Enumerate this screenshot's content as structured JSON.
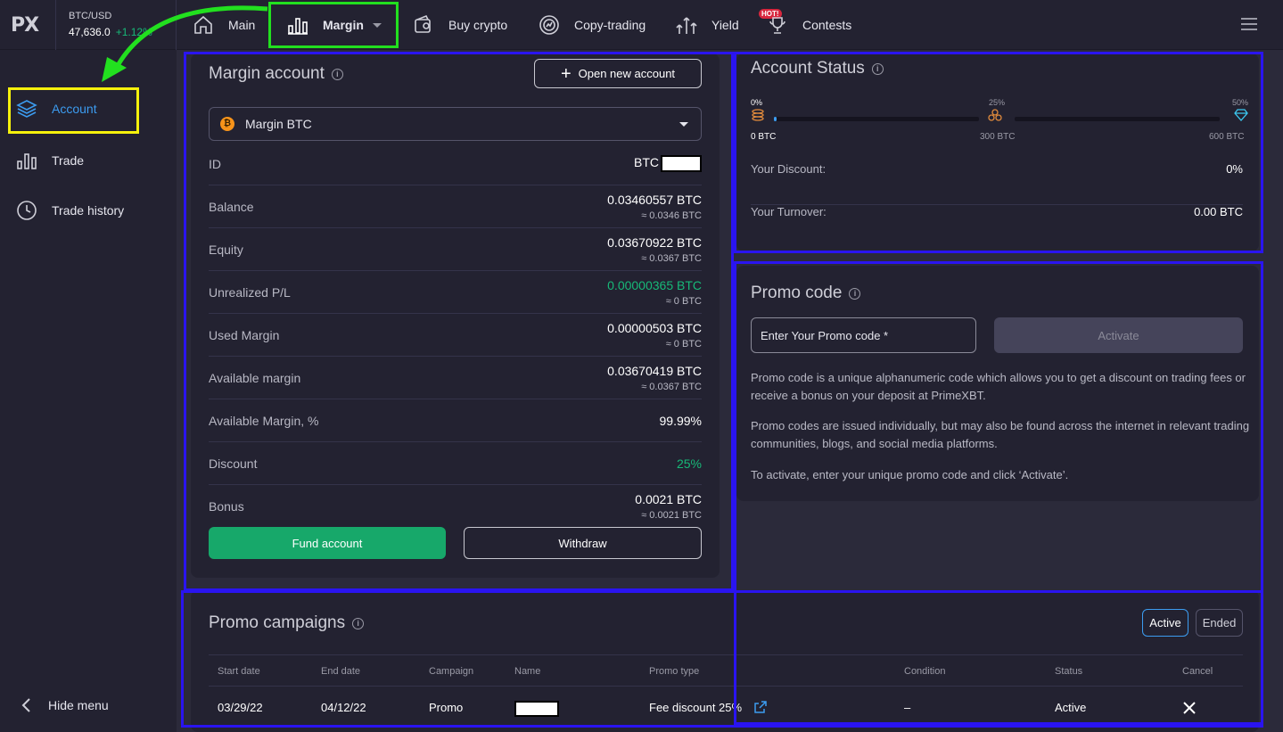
{
  "app": {
    "logo_main": "PX",
    "pair": "BTC/USD",
    "price": "47,636.0",
    "change": "+1.12%"
  },
  "nav": {
    "main": "Main",
    "margin": "Margin",
    "buy_crypto": "Buy crypto",
    "copy_trading": "Copy-trading",
    "yield": "Yield",
    "contests": "Contests",
    "hot_badge": "HOT!"
  },
  "sidebar": {
    "items": [
      {
        "label": "Account",
        "icon": "layers-icon",
        "active": true
      },
      {
        "label": "Trade",
        "icon": "bar-chart-icon"
      },
      {
        "label": "Trade history",
        "icon": "clock-icon"
      }
    ],
    "hide_menu": "Hide menu"
  },
  "margin_account": {
    "title": "Margin account",
    "open_new_account": "Open new account",
    "selected_account": "Margin BTC",
    "rows": {
      "id": {
        "label": "ID",
        "value": "BTC"
      },
      "balance": {
        "label": "Balance",
        "value": "0.03460557 BTC",
        "sub": "≈ 0.0346 BTC"
      },
      "equity": {
        "label": "Equity",
        "value": "0.03670922 BTC",
        "sub": "≈ 0.0367 BTC"
      },
      "unrealized": {
        "label": "Unrealized P/L",
        "value": "0.00000365 BTC",
        "sub": "≈ 0 BTC"
      },
      "used_margin": {
        "label": "Used Margin",
        "value": "0.00000503 BTC",
        "sub": "≈ 0 BTC"
      },
      "available_margin": {
        "label": "Available margin",
        "value": "0.03670419 BTC",
        "sub": "≈ 0.0367 BTC"
      },
      "available_margin_pct": {
        "label": "Available Margin, %",
        "value": "99.99%"
      },
      "discount": {
        "label": "Discount",
        "value": "25%"
      },
      "bonus": {
        "label": "Bonus",
        "value": "0.0021 BTC",
        "sub": "≈ 0.0021 BTC"
      }
    },
    "fund_account": "Fund account",
    "withdraw": "Withdraw"
  },
  "account_status": {
    "title": "Account Status",
    "levels": [
      {
        "pct": "0%",
        "amount": "0 BTC"
      },
      {
        "pct": "25%",
        "amount": "300 BTC"
      },
      {
        "pct": "50%",
        "amount": "600 BTC"
      }
    ],
    "progress_fraction": 0.0,
    "your_discount_label": "Your Discount:",
    "your_discount_value": "0%",
    "your_turnover_label": "Your Turnover:",
    "your_turnover_value": "0.00 BTC"
  },
  "promo_code": {
    "title": "Promo code",
    "placeholder": "Enter Your Promo code *",
    "activate": "Activate",
    "text1": "Promo code is a unique alphanumeric code which allows you to get a discount on trading fees or receive a bonus on your deposit at PrimeXBT.",
    "text2": "Promo codes are issued individually, but may also be found across the internet in relevant trading communities, blogs, and social media platforms.",
    "text3": "To activate, enter your unique promo code and click ‘Activate’."
  },
  "promo_campaigns": {
    "title": "Promo campaigns",
    "toggle_active": "Active",
    "toggle_ended": "Ended",
    "columns": [
      "Start date",
      "End date",
      "Campaign",
      "Name",
      "Promo type",
      "Condition",
      "Status",
      "Cancel"
    ],
    "rows": [
      {
        "start": "03/29/22",
        "end": "04/12/22",
        "campaign": "Promo",
        "promo_type": "Fee discount 25%",
        "condition": "–",
        "status": "Active"
      }
    ]
  },
  "colors": {
    "accent_blue": "#3c9cf0",
    "positive_green": "#17b978",
    "fund_green": "#17a86a",
    "highlight_blue": "#2a14f0",
    "highlight_green": "#22e01f",
    "highlight_yellow": "#f5f10c"
  }
}
